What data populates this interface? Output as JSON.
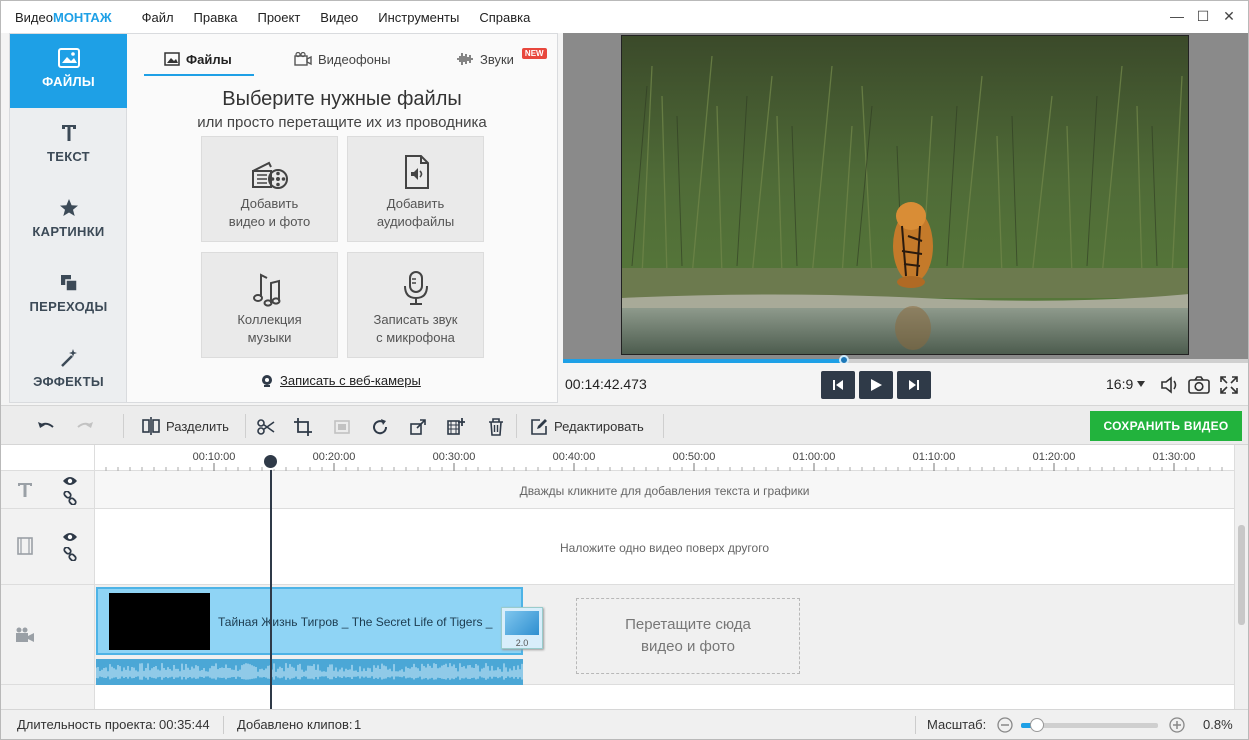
{
  "app": {
    "logo_prefix": "Видео",
    "logo_brand": "МОНТАЖ"
  },
  "menu": [
    "Файл",
    "Правка",
    "Проект",
    "Видео",
    "Инструменты",
    "Справка"
  ],
  "window_controls": {
    "minimize": "—",
    "maximize": "☐",
    "close": "✕"
  },
  "sidebar": {
    "items": [
      {
        "label": "ФАЙЛЫ",
        "icon": "image-icon",
        "active": true
      },
      {
        "label": "ТЕКСТ",
        "icon": "text-icon",
        "active": false
      },
      {
        "label": "КАРТИНКИ",
        "icon": "star-icon",
        "active": false
      },
      {
        "label": "ПЕРЕХОДЫ",
        "icon": "transitions-icon",
        "active": false
      },
      {
        "label": "ЭФФЕКТЫ",
        "icon": "magic-wand-icon",
        "active": false
      }
    ]
  },
  "panel": {
    "tabs": [
      {
        "label": "Файлы",
        "icon": "image-icon"
      },
      {
        "label": "Видеофоны",
        "icon": "video-backgrounds-icon"
      },
      {
        "label": "Звуки",
        "icon": "sound-wave-icon",
        "badge": "NEW"
      }
    ],
    "title": "Выберите нужные файлы",
    "subtitle": "или просто перетащите их из проводника",
    "tiles": [
      {
        "line1": "Добавить",
        "line2": "видео и фото",
        "icon": "film-reel-icon"
      },
      {
        "line1": "Добавить",
        "line2": "аудиофайлы",
        "icon": "audio-file-icon"
      },
      {
        "line1": "Коллекция",
        "line2": "музыки",
        "icon": "music-notes-icon"
      },
      {
        "line1": "Записать звук",
        "line2": "с микрофона",
        "icon": "microphone-icon"
      }
    ],
    "webcam_link": "Записать с веб-камеры"
  },
  "preview": {
    "timecode": "00:14:42.473",
    "aspect": "16:9",
    "progress": 0.41
  },
  "toolbar": {
    "split_label": "Разделить",
    "edit_label": "Редактировать",
    "save_label": "СОХРАНИТЬ ВИДЕО"
  },
  "timeline": {
    "ticks": [
      "00:10:00",
      "00:20:00",
      "00:30:00",
      "00:40:00",
      "00:50:00",
      "01:00:00",
      "01:10:00",
      "01:20:00",
      "01:30:00"
    ],
    "text_track_hint": "Дважды кликните для добавления текста и графики",
    "overlay_track_hint": "Наложите одно видео поверх другого",
    "clip_title": "Тайная Жизнь Тигров _ The Secret Life of Tigers _",
    "transition_label": "2.0",
    "drop_line1": "Перетащите сюда",
    "drop_line2": "видео и фото"
  },
  "status": {
    "duration_label": "Длительность проекта:",
    "duration_value": "00:35:44",
    "clips_label": "Добавлено клипов:",
    "clips_value": "1",
    "zoom_label": "Масштаб:",
    "zoom_value": "0.8%",
    "zoom_level": 0.12
  },
  "colors": {
    "accent": "#1ea0e6",
    "save_green": "#22b33d",
    "clip_blue": "#8fd4f5",
    "dark_button": "#2f3a48"
  }
}
